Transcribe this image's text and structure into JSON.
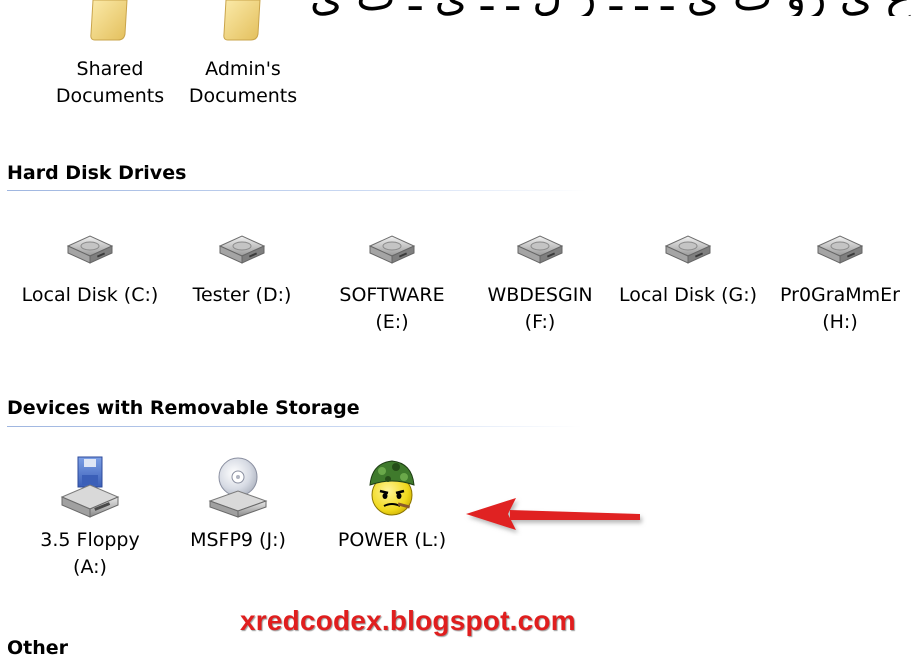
{
  "header_text": "ع ي رو ت ي ـ ـ ـ ر ل ـ ـ ي ـ ت ي",
  "folders": [
    {
      "label_line1": "Shared",
      "label_line2": "Documents"
    },
    {
      "label_line1": "Admin's",
      "label_line2": "Documents"
    }
  ],
  "hard_disk_drives": {
    "title": "Hard Disk Drives",
    "items": [
      {
        "line1": "Local Disk (C:)",
        "line2": ""
      },
      {
        "line1": "Tester (D:)",
        "line2": ""
      },
      {
        "line1": "SOFTWARE",
        "line2": "(E:)"
      },
      {
        "line1": "WBDESGIN",
        "line2": "(F:)"
      },
      {
        "line1": "Local Disk (G:)",
        "line2": ""
      },
      {
        "line1": "Pr0GraMmEr",
        "line2": "(H:)"
      }
    ]
  },
  "removable": {
    "title": "Devices with Removable Storage",
    "items": [
      {
        "line1": "3.5 Floppy",
        "line2": "(A:)",
        "icon": "floppy-drive-icon"
      },
      {
        "line1": "MSFP9 (J:)",
        "line2": "",
        "icon": "cd-drive-icon"
      },
      {
        "line1": "POWER (L:)",
        "line2": "",
        "icon": "soldier-smiley-icon"
      }
    ]
  },
  "other": {
    "title": "Other"
  },
  "watermark": "xredcodex.blogspot.com",
  "colors": {
    "header_line": "#9fb6e0",
    "watermark": "#e01e1e",
    "arrow": "#e02020",
    "folder": "#f3d98b"
  }
}
